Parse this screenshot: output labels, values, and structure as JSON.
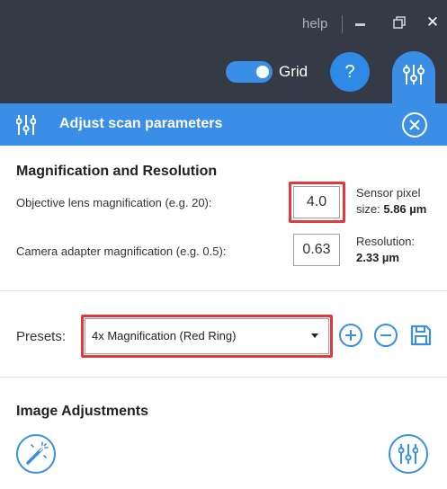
{
  "window": {
    "help_label": "help",
    "controls": [
      "minimize",
      "restore",
      "close"
    ]
  },
  "toolbar": {
    "grid_label": "Grid",
    "grid_enabled": true,
    "help_button_label": "?"
  },
  "panel": {
    "title": "Adjust scan parameters"
  },
  "magnification": {
    "section_title": "Magnification and Resolution",
    "objective_label": "Objective lens magnification (e.g. 20):",
    "objective_value": "4.0",
    "camera_label": "Camera adapter magnification (e.g. 0.5):",
    "camera_value": "0.63",
    "sensor_label_1": "Sensor pixel",
    "sensor_label_2": "size:",
    "sensor_value": "5.86 µm",
    "resolution_label": "Resolution:",
    "resolution_value": "2.33 µm"
  },
  "presets": {
    "label": "Presets:",
    "selected": "4x Magnification (Red Ring)"
  },
  "image_adjustments": {
    "section_title": "Image Adjustments"
  },
  "colors": {
    "dark_bar": "#353a47",
    "accent": "#3a8ee6",
    "highlight": "#e03a3e"
  },
  "icons": [
    "minimize-icon",
    "restore-icon",
    "close-icon",
    "help-icon",
    "sliders-icon",
    "close-circle-icon",
    "add-icon",
    "remove-icon",
    "save-icon",
    "magic-wand-icon"
  ]
}
